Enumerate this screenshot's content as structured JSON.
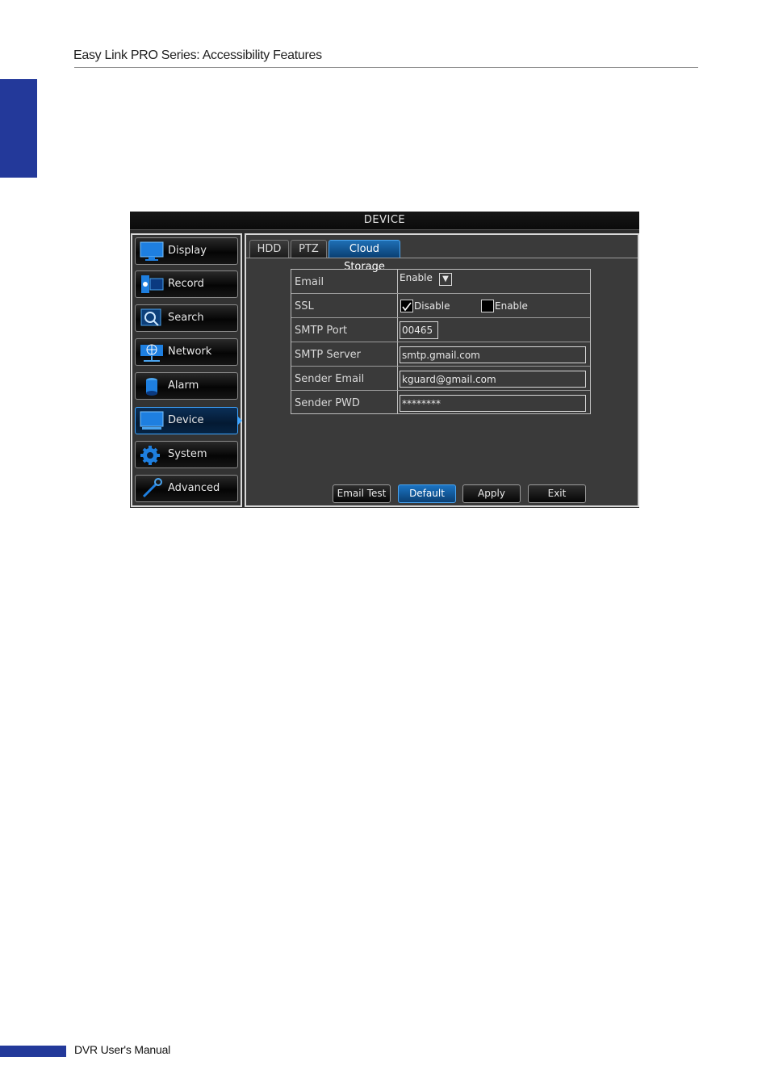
{
  "document": {
    "header_title": "Easy Link PRO Series: Accessibility Features",
    "footer_text": "DVR User's Manual",
    "accent_color": "#23399a"
  },
  "dvr": {
    "window_title": "DEVICE",
    "menu": [
      {
        "label": "Display",
        "icon": "monitor-icon"
      },
      {
        "label": "Record",
        "icon": "record-icon"
      },
      {
        "label": "Search",
        "icon": "magnifier-icon"
      },
      {
        "label": "Network",
        "icon": "network-globe-icon"
      },
      {
        "label": "Alarm",
        "icon": "alarm-siren-icon"
      },
      {
        "label": "Device",
        "icon": "device-monitor-icon",
        "active": true
      },
      {
        "label": "System",
        "icon": "gear-icon"
      },
      {
        "label": "Advanced",
        "icon": "wrench-icon"
      }
    ],
    "tabs": [
      {
        "label": "HDD"
      },
      {
        "label": "PTZ"
      },
      {
        "label": "Cloud Storage",
        "active": true
      }
    ],
    "form": {
      "email_label": "Email",
      "email_value": "Enable",
      "ssl_label": "SSL",
      "ssl_disable_label": "Disable",
      "ssl_disable_checked": true,
      "ssl_enable_label": "Enable",
      "ssl_enable_checked": false,
      "smtp_port_label": "SMTP Port",
      "smtp_port_value": "00465",
      "smtp_server_label": "SMTP Server",
      "smtp_server_value": "smtp.gmail.com",
      "sender_email_label": "Sender Email",
      "sender_email_value": "kguard@gmail.com",
      "sender_pwd_label": "Sender PWD",
      "sender_pwd_value": "********"
    },
    "buttons": {
      "email_test": "Email Test",
      "default": "Default",
      "apply": "Apply",
      "exit": "Exit"
    }
  }
}
